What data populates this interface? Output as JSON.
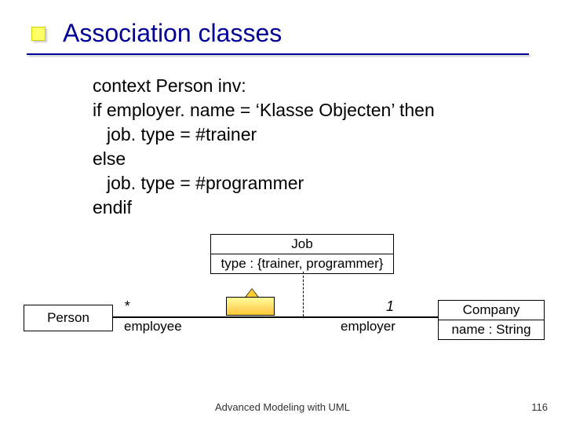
{
  "title": "Association classes",
  "code": {
    "l1": "context Person inv:",
    "l2": "if employer. name = ‘Klasse Objecten’ then",
    "l3": "job. type = #trainer",
    "l4": "else",
    "l5": "job. type = #programmer",
    "l6": "endif"
  },
  "diagram": {
    "job": {
      "name": "Job",
      "attr": "type : {trainer, programmer}"
    },
    "person": {
      "name": "Person"
    },
    "company": {
      "name": "Company",
      "attr": "name : String"
    },
    "mult": {
      "left": "*",
      "right": "1"
    },
    "role": {
      "left": "employee",
      "right": "employer"
    }
  },
  "footer": "Advanced Modeling with UML",
  "page": "116"
}
